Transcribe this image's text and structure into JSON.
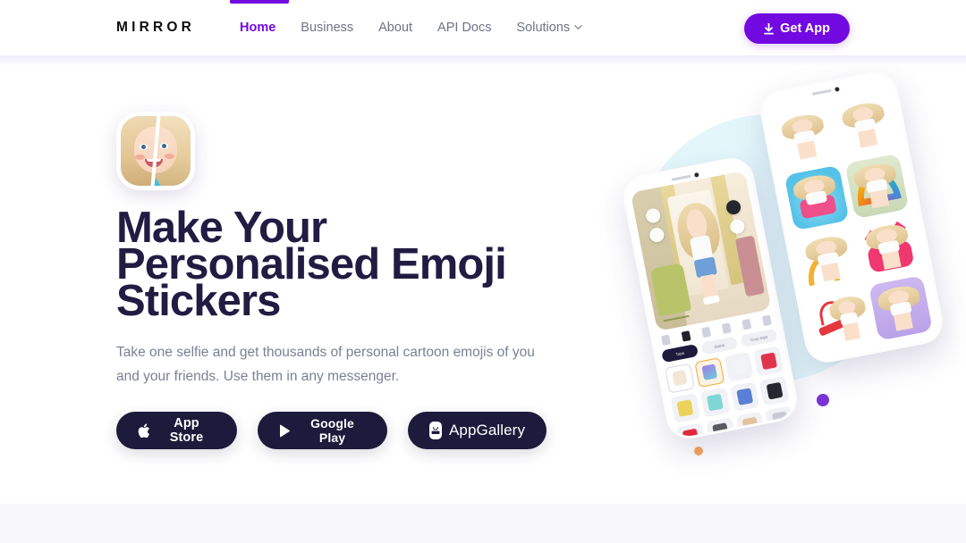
{
  "brand": {
    "logo": "MIRROR",
    "accent": "#7209e0",
    "dark": "#1d1a3c",
    "heading_color": "#221c43"
  },
  "header": {
    "nav": [
      {
        "label": "Home",
        "active": true
      },
      {
        "label": "Business",
        "active": false
      },
      {
        "label": "About",
        "active": false
      },
      {
        "label": "API Docs",
        "active": false
      },
      {
        "label": "Solutions",
        "active": false,
        "has_dropdown": true
      }
    ],
    "cta": {
      "label": "Get App",
      "icon": "download-icon"
    }
  },
  "hero": {
    "avatar_icon": "split-face-avatar",
    "headline": "Make Your Personalised Emoji Stickers",
    "subtitle": "Take one selfie and get thousands of personal cartoon emojis of you and your friends. Use them in any messenger.",
    "store_buttons": [
      {
        "label": "App Store",
        "icon": "apple-icon"
      },
      {
        "label": "Google Play",
        "icon": "google-play-icon"
      },
      {
        "label": "AppGallery",
        "icon": "huawei-appgallery-icon"
      }
    ]
  },
  "artwork": {
    "phone_left": {
      "label": "avatar-dressing-room-screen",
      "chips": [
        "Tops",
        "Shirts",
        "Crop tops"
      ]
    },
    "phone_right": {
      "label": "sticker-pack-screen"
    },
    "dots": [
      {
        "name": "cyan-dot",
        "color": "#3ccde5"
      },
      {
        "name": "orange-dot",
        "color": "#f7a55c"
      },
      {
        "name": "purple-dot",
        "color": "#7a35d8"
      }
    ],
    "blob_color": "#e3f7fb"
  }
}
